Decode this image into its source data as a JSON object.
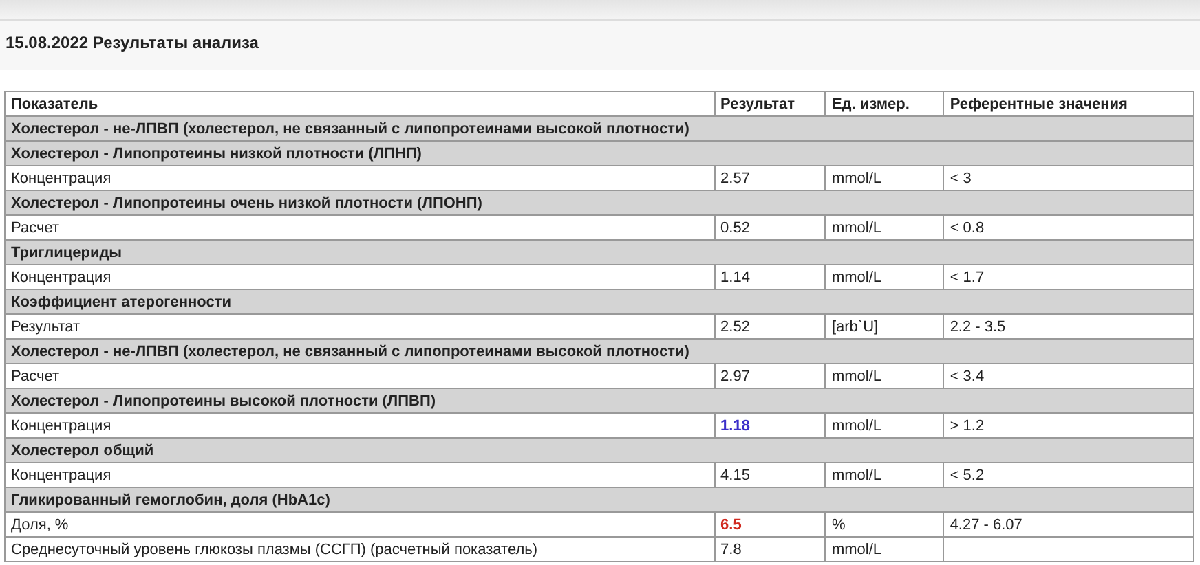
{
  "title": "15.08.2022 Результаты анализа",
  "columns": [
    "Показатель",
    "Результат",
    "Ед. измер.",
    "Референтные значения"
  ],
  "rows": [
    {
      "kind": "group",
      "label": "Холестерол - не-ЛПВП (холестерол, не связанный с липопротеинами высокой плотности)"
    },
    {
      "kind": "group",
      "label": "Холестерол - Липопротеины низкой плотности (ЛПНП)"
    },
    {
      "kind": "data",
      "label": "Концентрация",
      "result": "2.57",
      "out_of_range": false,
      "color": "#222222",
      "unit": "mmol/L",
      "reference": "< 3"
    },
    {
      "kind": "group",
      "label": "Холестерол - Липопротеины очень низкой плотности (ЛПОНП)"
    },
    {
      "kind": "data",
      "label": "Расчет",
      "result": "0.52",
      "out_of_range": false,
      "color": "#222222",
      "unit": "mmol/L",
      "reference": "< 0.8"
    },
    {
      "kind": "group",
      "label": "Триглицериды"
    },
    {
      "kind": "data",
      "label": "Концентрация",
      "result": "1.14",
      "out_of_range": false,
      "color": "#222222",
      "unit": "mmol/L",
      "reference": "< 1.7"
    },
    {
      "kind": "group",
      "label": "Коэффициент атерогенности"
    },
    {
      "kind": "data",
      "label": "Результат",
      "result": "2.52",
      "out_of_range": false,
      "color": "#222222",
      "unit": "[arb`U]",
      "reference": "2.2 - 3.5"
    },
    {
      "kind": "group",
      "label": "Холестерол - не-ЛПВП (холестерол, не связанный с липопротеинами высокой плотности)"
    },
    {
      "kind": "data",
      "label": "Расчет",
      "result": "2.97",
      "out_of_range": false,
      "color": "#222222",
      "unit": "mmol/L",
      "reference": "< 3.4"
    },
    {
      "kind": "group",
      "label": "Холестерол - Липопротеины высокой плотности (ЛПВП)"
    },
    {
      "kind": "data",
      "label": "Концентрация",
      "result": "1.18",
      "out_of_range": true,
      "color": "#3b2fc9",
      "unit": "mmol/L",
      "reference": "> 1.2"
    },
    {
      "kind": "group",
      "label": "Холестерол общий"
    },
    {
      "kind": "data",
      "label": "Концентрация",
      "result": "4.15",
      "out_of_range": false,
      "color": "#222222",
      "unit": "mmol/L",
      "reference": "< 5.2"
    },
    {
      "kind": "group",
      "label": "Гликированный гемоглобин, доля (HbA1c)"
    },
    {
      "kind": "data",
      "label": "Доля, %",
      "result": "6.5",
      "out_of_range": true,
      "color": "#d0281e",
      "unit": "%",
      "reference": "4.27 - 6.07"
    },
    {
      "kind": "data",
      "label": "Среднесуточный уровень глюкозы плазмы (ССГП) (расчетный показатель)",
      "result": "7.8",
      "out_of_range": false,
      "color": "#222222",
      "unit": "mmol/L"
    }
  ]
}
